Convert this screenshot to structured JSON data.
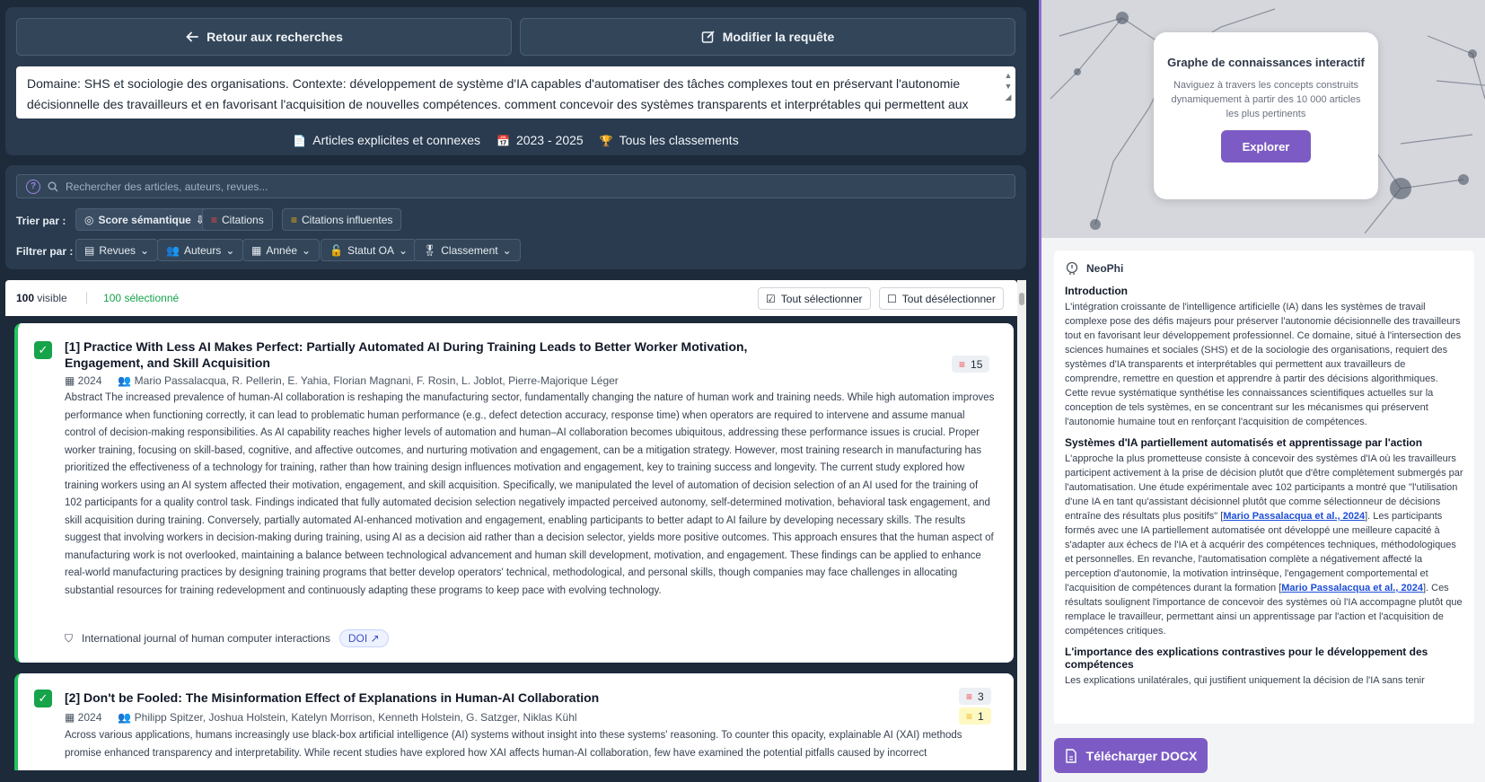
{
  "nav": {
    "back_label": "Retour aux recherches",
    "edit_label": "Modifier la requête"
  },
  "query": {
    "text": "Domaine: SHS et sociologie des organisations. Contexte: développement de système d'IA capables d'automatiser des tâches complexes tout en préservant l'autonomie décisionnelle des travailleurs et en favorisant l'acquisition de nouvelles compétences. comment concevoir des systèmes transparents et interprétables qui permettent aux"
  },
  "meta": {
    "scope": "Articles explicites et connexes",
    "years": "2023 - 2025",
    "ranking": "Tous les classements"
  },
  "search": {
    "placeholder": "Rechercher des articles, auteurs, revues...",
    "help": "?"
  },
  "sort": {
    "label": "Trier par :",
    "options": [
      "Score sémantique",
      "Citations",
      "Citations influentes"
    ]
  },
  "filter": {
    "label": "Filtrer par :",
    "options": [
      "Revues",
      "Auteurs",
      "Année",
      "Statut OA",
      "Classement"
    ]
  },
  "list": {
    "visible_count": "100",
    "visible_label": "visible",
    "selected_count": "100",
    "selected_label": "sélectionné",
    "select_all": "Tout sélectionner",
    "deselect_all": "Tout désélectionner"
  },
  "articles": [
    {
      "title": "[1] Practice With Less AI Makes Perfect: Partially Automated AI During Training Leads to Better Worker Motivation, Engagement, and Skill Acquisition",
      "year": "2024",
      "authors": "Mario Passalacqua, R. Pellerin, E. Yahia, Florian Magnani, F. Rosin, L. Joblot, Pierre-Majorique Léger",
      "citations": "15",
      "abstract": "Abstract The increased prevalence of human-AI collaboration is reshaping the manufacturing sector, fundamentally changing the nature of human work and training needs. While high automation improves performance when functioning correctly, it can lead to problematic human performance (e.g., defect detection accuracy, response time) when operators are required to intervene and assume manual control of decision-making responsibilities. As AI capability reaches higher levels of automation and human–AI collaboration becomes ubiquitous, addressing these performance issues is crucial. Proper worker training, focusing on skill-based, cognitive, and affective outcomes, and nurturing motivation and engagement, can be a mitigation strategy. However, most training research in manufacturing has prioritized the effectiveness of a technology for training, rather than how training design influences motivation and engagement, key to training success and longevity. The current study explored how training workers using an AI system affected their motivation, engagement, and skill acquisition. Specifically, we manipulated the level of automation of decision selection of an AI used for the training of 102 participants for a quality control task. Findings indicated that fully automated decision selection negatively impacted perceived autonomy, self-determined motivation, behavioral task engagement, and skill acquisition during training. Conversely, partially automated AI-enhanced motivation and engagement, enabling participants to better adapt to AI failure by developing necessary skills. The results suggest that involving workers in decision-making during training, using AI as a decision aid rather than a decision selector, yields more positive outcomes. This approach ensures that the human aspect of manufacturing work is not overlooked, maintaining a balance between technological advancement and human skill development, motivation, and engagement. These findings can be applied to enhance real-world manufacturing practices by designing training programs that better develop operators' technical, methodological, and personal skills, though companies may face challenges in allocating substantial resources for training redevelopment and continuously adapting these programs to keep pace with evolving technology.",
      "journal": "International journal of human computer interactions",
      "doi": "DOI"
    },
    {
      "title": "[2] Don't be Fooled: The Misinformation Effect of Explanations in Human-AI Collaboration",
      "year": "2024",
      "authors": "Philipp Spitzer, Joshua Holstein, Katelyn Morrison, Kenneth Holstein, G. Satzger, Niklas Kühl",
      "citations": "3",
      "influential": "1",
      "abstract": "Across various applications, humans increasingly use black-box artificial intelligence (AI) systems without insight into these systems' reasoning. To counter this opacity, explainable AI (XAI) methods promise enhanced transparency and interpretability. While recent studies have explored how XAI affects human-AI collaboration, few have examined the potential pitfalls caused by incorrect"
    }
  ],
  "graph": {
    "title": "Graphe de connaissances interactif",
    "description": "Naviguez à travers les concepts construits dynamiquement à partir des 10 000 articles les plus pertinents",
    "explore_label": "Explorer"
  },
  "report": {
    "author": "NeoPhi",
    "sections": {
      "intro_title": "Introduction",
      "intro_text": "L'intégration croissante de l'intelligence artificielle (IA) dans les systèmes de travail complexe pose des défis majeurs pour préserver l'autonomie décisionnelle des travailleurs tout en favorisant leur développement professionnel. Ce domaine, situé à l'intersection des sciences humaines et sociales (SHS) et de la sociologie des organisations, requiert des systèmes d'IA transparents et interprétables qui permettent aux travailleurs de comprendre, remettre en question et apprendre à partir des décisions algorithmiques. Cette revue systématique synthétise les connaissances scientifiques actuelles sur la conception de tels systèmes, en se concentrant sur les mécanismes qui préservent l'autonomie humaine tout en renforçant l'acquisition de compétences.",
      "s2_title": "Systèmes d'IA partiellement automatisés et apprentissage par l'action",
      "s2_text_a": "L'approche la plus prometteuse consiste à concevoir des systèmes d'IA où les travailleurs participent activement à la prise de décision plutôt que d'être complètement submergés par l'automatisation. Une étude expérimentale avec 102 participants a montré que \"l'utilisation d'une IA en tant qu'assistant décisionnel plutôt que comme sélectionneur de décisions entraîne des résultats plus positifs\" [",
      "s2_cite_1": "Mario Passalacqua et al., 2024",
      "s2_text_b": "]. Les participants formés avec une IA partiellement automatisée ont développé une meilleure capacité à s'adapter aux échecs de l'IA et à acquérir des compétences techniques, méthodologiques et personnelles. En revanche, l'automatisation complète a négativement affecté la perception d'autonomie, la motivation intrinsèque, l'engagement comportemental et l'acquisition de compétences durant la formation [",
      "s2_cite_2": "Mario Passalacqua et al., 2024",
      "s2_text_c": "]. Ces résultats soulignent l'importance de concevoir des systèmes où l'IA accompagne plutôt que remplace le travailleur, permettant ainsi un apprentissage par l'action et l'acquisition de compétences critiques.",
      "s3_title": "L'importance des explications contrastives pour le développement des compétences",
      "s3_text": "Les explications unilatérales, qui justifient uniquement la décision de l'IA sans tenir"
    },
    "download_label": "Télécharger DOCX"
  }
}
